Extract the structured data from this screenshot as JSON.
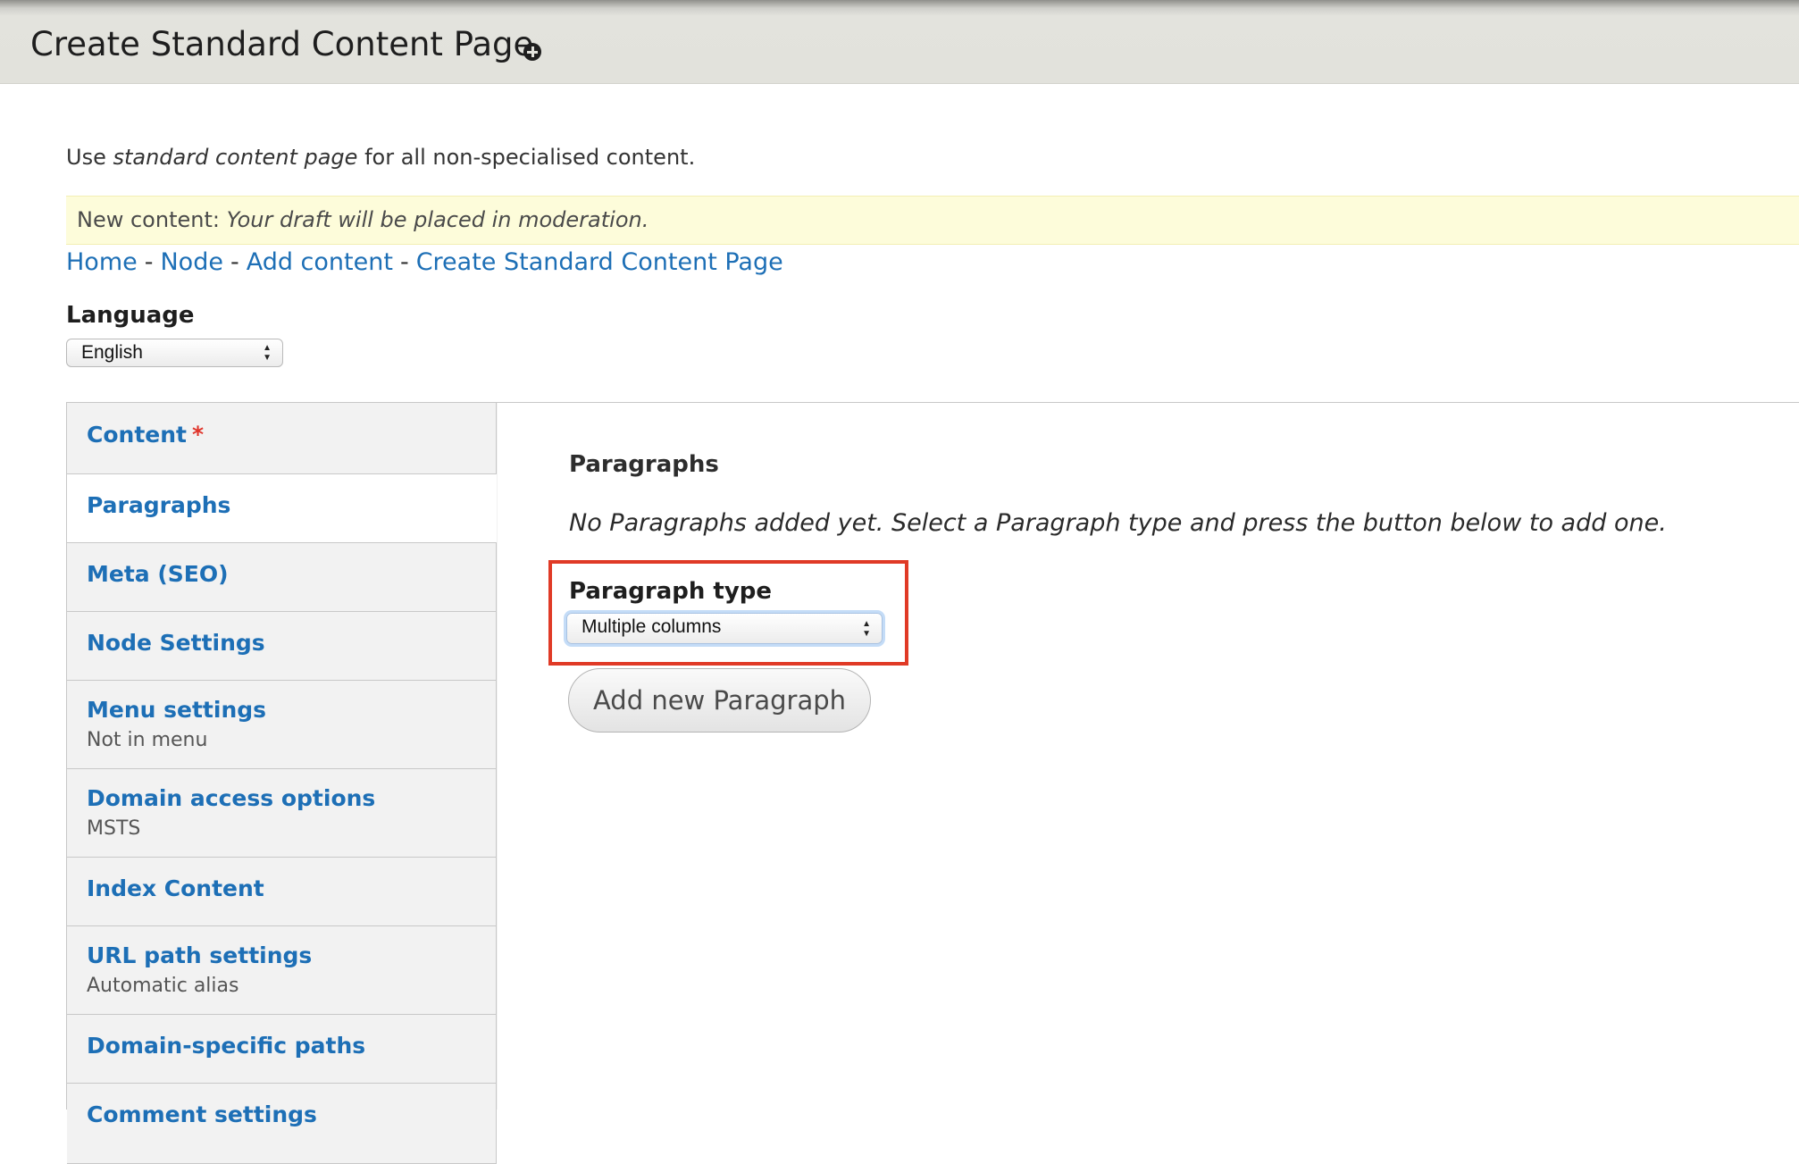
{
  "header": {
    "title": "Create Standard Content Page",
    "shortcut_icon": "plus-circle-icon"
  },
  "help": {
    "prefix": "Use ",
    "emphasis": "standard content page",
    "suffix": " for all non-specialised content."
  },
  "moderation": {
    "label": "New content: ",
    "message": "Your draft will be placed in moderation."
  },
  "breadcrumb": {
    "items": [
      "Home",
      "Node",
      "Add content",
      "Create Standard Content Page"
    ],
    "separator": "-"
  },
  "language": {
    "label": "Language",
    "selected": "English"
  },
  "vertical_tabs": [
    {
      "label": "Content",
      "required_marker": "*",
      "summary": ""
    },
    {
      "label": "Paragraphs",
      "summary": "",
      "selected": true
    },
    {
      "label": "Meta (SEO)",
      "summary": ""
    },
    {
      "label": "Node Settings",
      "summary": ""
    },
    {
      "label": "Menu settings",
      "summary": "Not in menu"
    },
    {
      "label": "Domain access options",
      "summary": "MSTS"
    },
    {
      "label": "Index Content",
      "summary": ""
    },
    {
      "label": "URL path settings",
      "summary": "Automatic alias"
    },
    {
      "label": "Domain-specific paths",
      "summary": ""
    },
    {
      "label": "Comment settings",
      "summary": ""
    }
  ],
  "paragraphs": {
    "title": "Paragraphs",
    "description": "No Paragraphs added yet. Select a Paragraph type and press the button below to add one.",
    "type_label": "Paragraph type",
    "type_selected": "Multiple columns",
    "add_button": "Add new Paragraph"
  },
  "colors": {
    "link": "#1d6fb6",
    "highlight": "#e03a26",
    "moderation_bg": "#fdfcda",
    "required": "#e0342a"
  }
}
